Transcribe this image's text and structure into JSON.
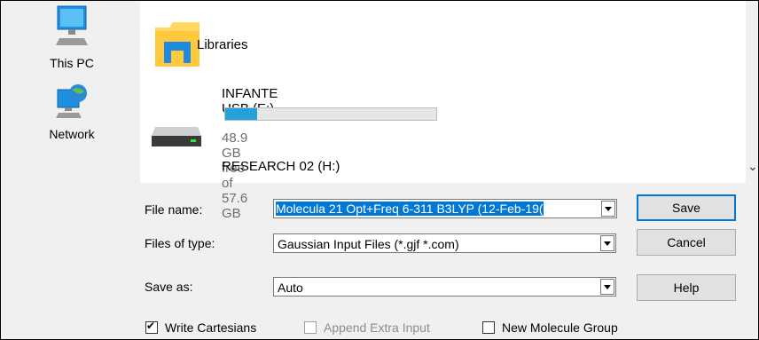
{
  "sidebar": {
    "items": [
      {
        "label": "This PC",
        "icon": "computer-icon"
      },
      {
        "label": "Network",
        "icon": "network-icon"
      }
    ]
  },
  "locations": {
    "libraries": {
      "label": "Libraries",
      "icon": "libraries-icon"
    },
    "drive1": {
      "label": "INFANTE USB (E:)",
      "free_text": "48.9 GB free of 57.6 GB",
      "used_fraction": 0.15,
      "icon": "drive-icon"
    },
    "drive2": {
      "label": "RESEARCH 02 (H:)"
    }
  },
  "form": {
    "file_name_label": "File name:",
    "file_name_value": "Molecula 21 Opt+Freq 6-311 B3LYP (12-Feb-19(",
    "files_of_type_label": "Files of type:",
    "files_of_type_value": "Gaussian Input Files (*.gjf *.com)",
    "save_as_label": "Save as:",
    "save_as_value": "Auto"
  },
  "buttons": {
    "save": "Save",
    "cancel": "Cancel",
    "help": "Help"
  },
  "options": {
    "write_cartesians": {
      "label": "Write Cartesians",
      "checked": true,
      "enabled": true
    },
    "append_extra_input": {
      "label": "Append Extra Input",
      "checked": false,
      "enabled": false
    },
    "new_molecule_group": {
      "label": "New Molecule Group",
      "checked": false,
      "enabled": true
    }
  },
  "colors": {
    "accent": "#0078d7",
    "progress": "#26a0da",
    "selection": "#0078d7"
  }
}
